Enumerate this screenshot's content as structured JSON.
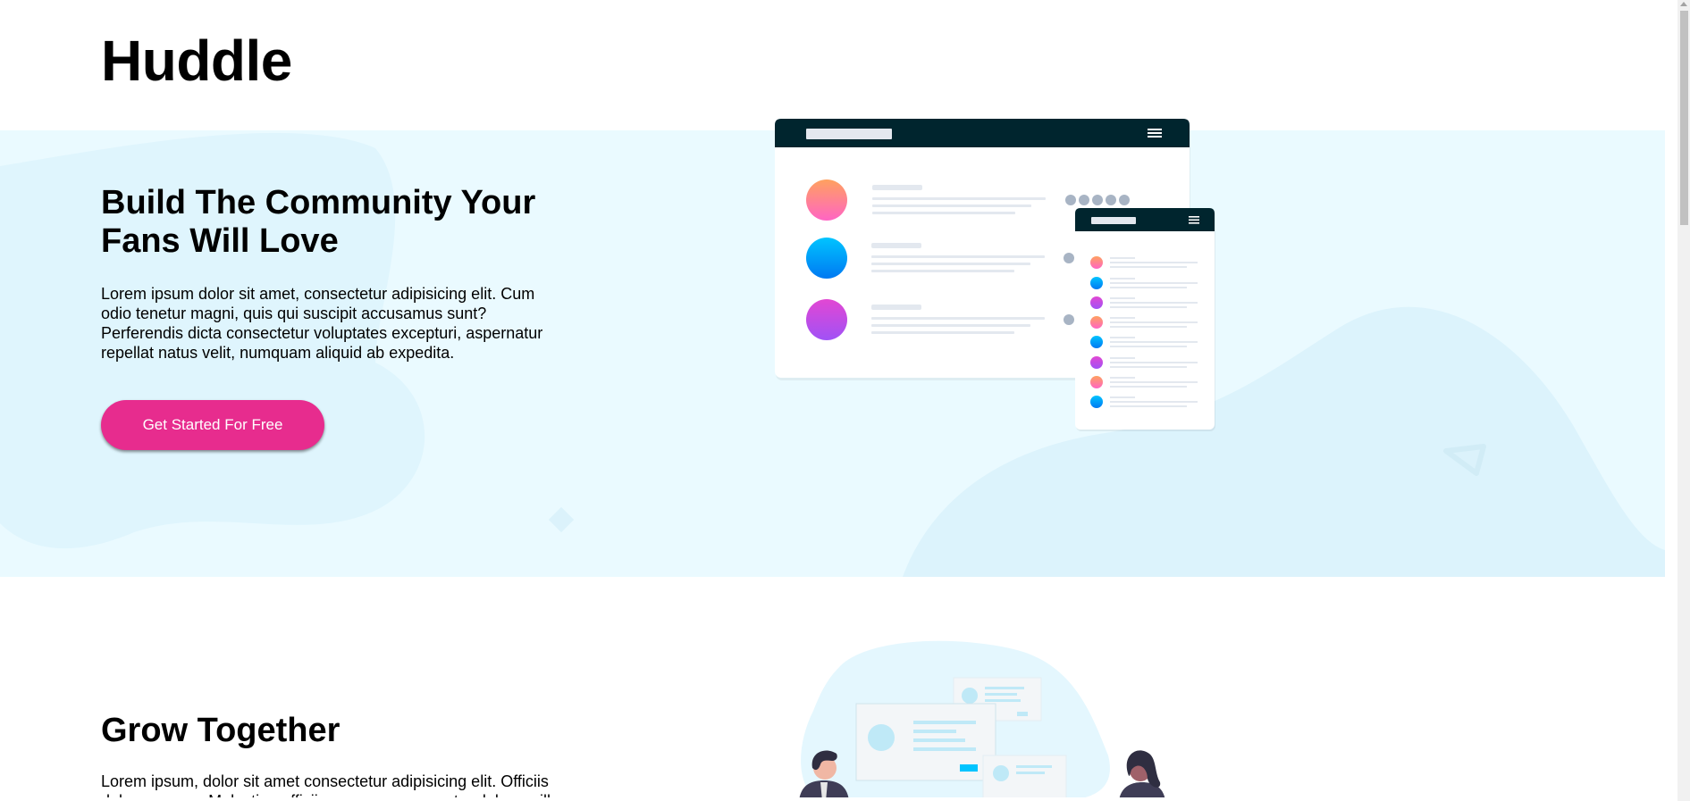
{
  "brand": {
    "name": "Huddle"
  },
  "hero": {
    "title": "Build The Community Your Fans Will Love",
    "body": "Lorem ipsum dolor sit amet, consectetur adipisicing elit. Cum odio tenetur magni, quis qui suscipit accusamus sunt? Perferendis dicta consectetur voluptates excepturi, aspernatur repellat natus velit, numquam aliquid ab expedita.",
    "cta_label": "Get Started For Free"
  },
  "section2": {
    "title": "Grow Together",
    "body": "Lorem ipsum, dolor sit amet consectetur adipisicing elit. Officiis dolorum quae. Molestiae officiis nemo consequuntur dolorem illo."
  },
  "colors": {
    "hero_background": "#eafaff",
    "cta": "#e72c8e",
    "mockup_header": "#00252e",
    "avatar_gradients": [
      [
        "#ffa15f",
        "#ff65c4"
      ],
      [
        "#00c4ff",
        "#0079f2"
      ],
      [
        "#e247d3",
        "#a052f6"
      ]
    ]
  },
  "icons": {
    "mockup_menu": "hamburger-menu-icon",
    "hero_decor": "triangle-decoration-icon"
  }
}
